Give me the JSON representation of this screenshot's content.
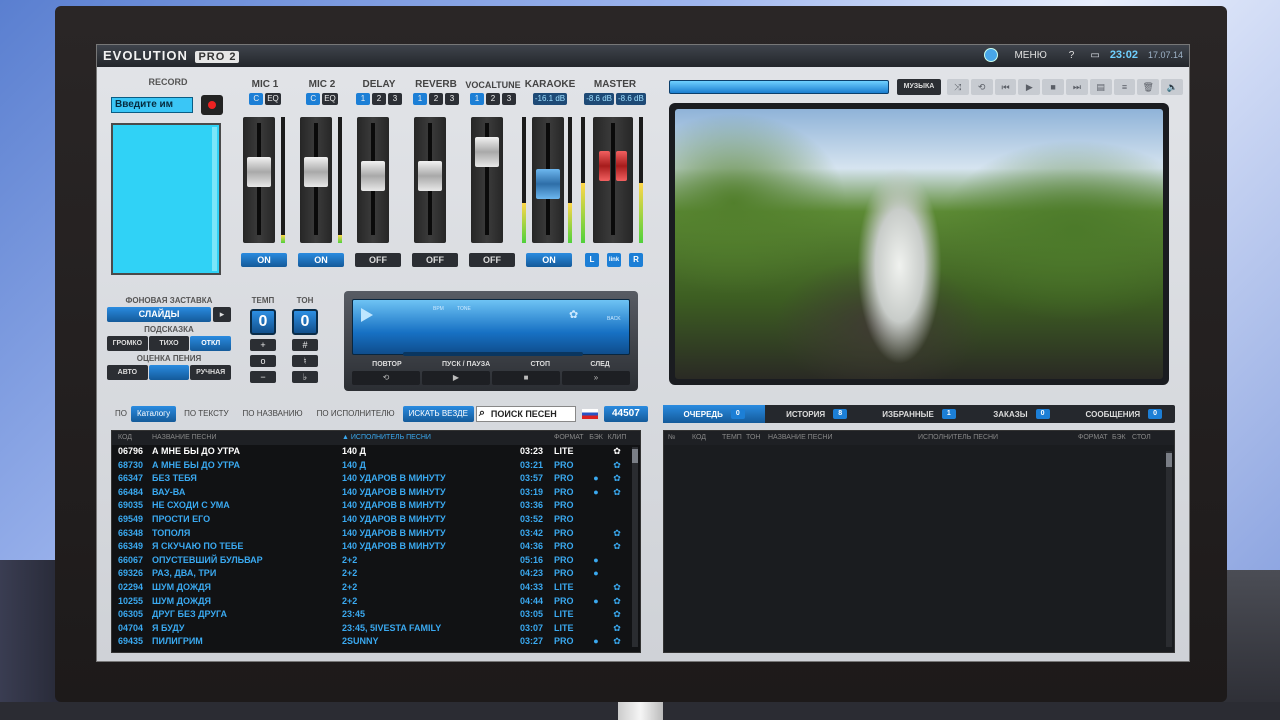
{
  "app": {
    "logo": "EVOLUTION",
    "logo_pro": "PRO 2",
    "menu_label": "МЕНЮ",
    "help_label": "?",
    "clock": "23:02",
    "date": "17.07.14"
  },
  "record": {
    "title": "RECORD",
    "input_value": "Введите им"
  },
  "mixer": {
    "channels": [
      {
        "name": "MIC 1",
        "btn1": "C",
        "btn2": "EQ",
        "state": "ON"
      },
      {
        "name": "MIC 2",
        "btn1": "C",
        "btn2": "EQ",
        "state": "ON"
      },
      {
        "name": "DELAY",
        "btn1": "1",
        "btn2": "2",
        "btn3": "3",
        "state": "OFF"
      },
      {
        "name": "REVERB",
        "btn1": "1",
        "btn2": "2",
        "btn3": "3",
        "state": "OFF"
      },
      {
        "name": "VOCALTUNE",
        "btn1": "1",
        "btn2": "2",
        "btn3": "3",
        "state": "OFF"
      },
      {
        "name": "KARAOKE",
        "db": "-16.1 dB",
        "state": "ON"
      },
      {
        "name": "MASTER",
        "db_l": "-8.6 dB",
        "db_r": "-8.6 dB",
        "l": "L",
        "link": "link",
        "r": "R"
      }
    ]
  },
  "background": {
    "title": "ФОНОВАЯ ЗАСТАВКА",
    "value": "СЛАЙДЫ",
    "hint_title": "ПОДСКАЗКА",
    "hint_options": [
      "ГРОМКО",
      "ТИХО",
      "ОТКЛ"
    ],
    "score_title": "ОЦЕНКА ПЕНИЯ",
    "score_options": [
      "АВТО",
      "",
      "РУЧНАЯ"
    ]
  },
  "tempo": {
    "tempo_label": "ТЕМП",
    "tone_label": "ТОН",
    "tempo_value": "0",
    "tone_value": "0"
  },
  "player": {
    "labels": [
      "ПОВТОР",
      "ПУСК / ПАУЗА",
      "СТОП",
      "СЛЕД"
    ],
    "screen_bpm": "BPM",
    "screen_tone": "TONE",
    "screen_back": "BACK"
  },
  "music": {
    "button": "МУЗЫКА"
  },
  "search": {
    "prefix": "ПО",
    "tabs": [
      "Каталогу",
      "ПО ТЕКСТУ",
      "ПО НАЗВАНИЮ",
      "ПО ИСПОЛНИТЕЛЮ",
      "ИСКАТЬ ВЕЗДЕ"
    ],
    "placeholder": "ПОИСК ПЕСЕН",
    "count": "44507"
  },
  "songs": {
    "headers": {
      "code": "КОД",
      "title": "НАЗВАНИЕ ПЕСНИ",
      "artist": "▲ ИСПОЛНИТЕЛЬ ПЕСНИ",
      "format": "ФОРМАТ",
      "bek": "БЭК",
      "clip": "КЛИП"
    },
    "rows": [
      {
        "code": "06796",
        "title": "А МНЕ БЫ ДО УТРА",
        "artist": "140 Д",
        "dur": "03:23",
        "fmt": "LITE",
        "bek": "",
        "clip": "✿"
      },
      {
        "code": "68730",
        "title": "А МНЕ БЫ ДО УТРА",
        "artist": "140 Д",
        "dur": "03:21",
        "fmt": "PRO",
        "bek": "",
        "clip": "✿"
      },
      {
        "code": "66347",
        "title": "БЕЗ ТЕБЯ",
        "artist": "140 УДАРОВ В МИНУТУ",
        "dur": "03:57",
        "fmt": "PRO",
        "bek": "●",
        "clip": "✿"
      },
      {
        "code": "66484",
        "title": "ВАУ-ВА",
        "artist": "140 УДАРОВ В МИНУТУ",
        "dur": "03:19",
        "fmt": "PRO",
        "bek": "●",
        "clip": "✿"
      },
      {
        "code": "69035",
        "title": "НЕ СХОДИ С УМА",
        "artist": "140 УДАРОВ В МИНУТУ",
        "dur": "03:36",
        "fmt": "PRO",
        "bek": "",
        "clip": ""
      },
      {
        "code": "69549",
        "title": "ПРОСТИ ЕГО",
        "artist": "140 УДАРОВ В МИНУТУ",
        "dur": "03:52",
        "fmt": "PRO",
        "bek": "",
        "clip": ""
      },
      {
        "code": "66348",
        "title": "ТОПОЛЯ",
        "artist": "140 УДАРОВ В МИНУТУ",
        "dur": "03:42",
        "fmt": "PRO",
        "bek": "",
        "clip": "✿"
      },
      {
        "code": "66349",
        "title": "Я СКУЧАЮ ПО ТЕБЕ",
        "artist": "140 УДАРОВ В МИНУТУ",
        "dur": "04:36",
        "fmt": "PRO",
        "bek": "",
        "clip": "✿"
      },
      {
        "code": "66067",
        "title": "ОПУСТЕВШИЙ БУЛЬВАР",
        "artist": "2+2",
        "dur": "05:16",
        "fmt": "PRO",
        "bek": "●",
        "clip": ""
      },
      {
        "code": "69326",
        "title": "РАЗ, ДВА, ТРИ",
        "artist": "2+2",
        "dur": "04:23",
        "fmt": "PRO",
        "bek": "●",
        "clip": ""
      },
      {
        "code": "02294",
        "title": "ШУМ ДОЖДЯ",
        "artist": "2+2",
        "dur": "04:33",
        "fmt": "LITE",
        "bek": "",
        "clip": "✿"
      },
      {
        "code": "10255",
        "title": "ШУМ ДОЖДЯ",
        "artist": "2+2",
        "dur": "04:44",
        "fmt": "PRO",
        "bek": "●",
        "clip": "✿"
      },
      {
        "code": "06305",
        "title": "ДРУГ БЕЗ ДРУГА",
        "artist": "23:45",
        "dur": "03:05",
        "fmt": "LITE",
        "bek": "",
        "clip": "✿"
      },
      {
        "code": "04704",
        "title": "Я БУДУ",
        "artist": "23:45, 5IVESTA FAMILY",
        "dur": "03:07",
        "fmt": "LITE",
        "bek": "",
        "clip": "✿"
      },
      {
        "code": "69435",
        "title": "ПИЛИГРИМ",
        "artist": "2SUNNY",
        "dur": "03:27",
        "fmt": "PRO",
        "bek": "●",
        "clip": "✿"
      }
    ]
  },
  "queue": {
    "tabs": [
      {
        "label": "ОЧЕРЕДЬ",
        "count": "0"
      },
      {
        "label": "ИСТОРИЯ",
        "count": "8"
      },
      {
        "label": "ИЗБРАННЫЕ",
        "count": "1"
      },
      {
        "label": "ЗАКАЗЫ",
        "count": "0"
      },
      {
        "label": "СООБЩЕНИЯ",
        "count": "0"
      }
    ],
    "headers": [
      "№",
      "КОД",
      "ТЕМП",
      "ТОН",
      "НАЗВАНИЕ ПЕСНИ",
      "ИСПОЛНИТЕЛЬ ПЕСНИ",
      "ФОРМАТ",
      "БЭК",
      "СТОЛ"
    ]
  }
}
